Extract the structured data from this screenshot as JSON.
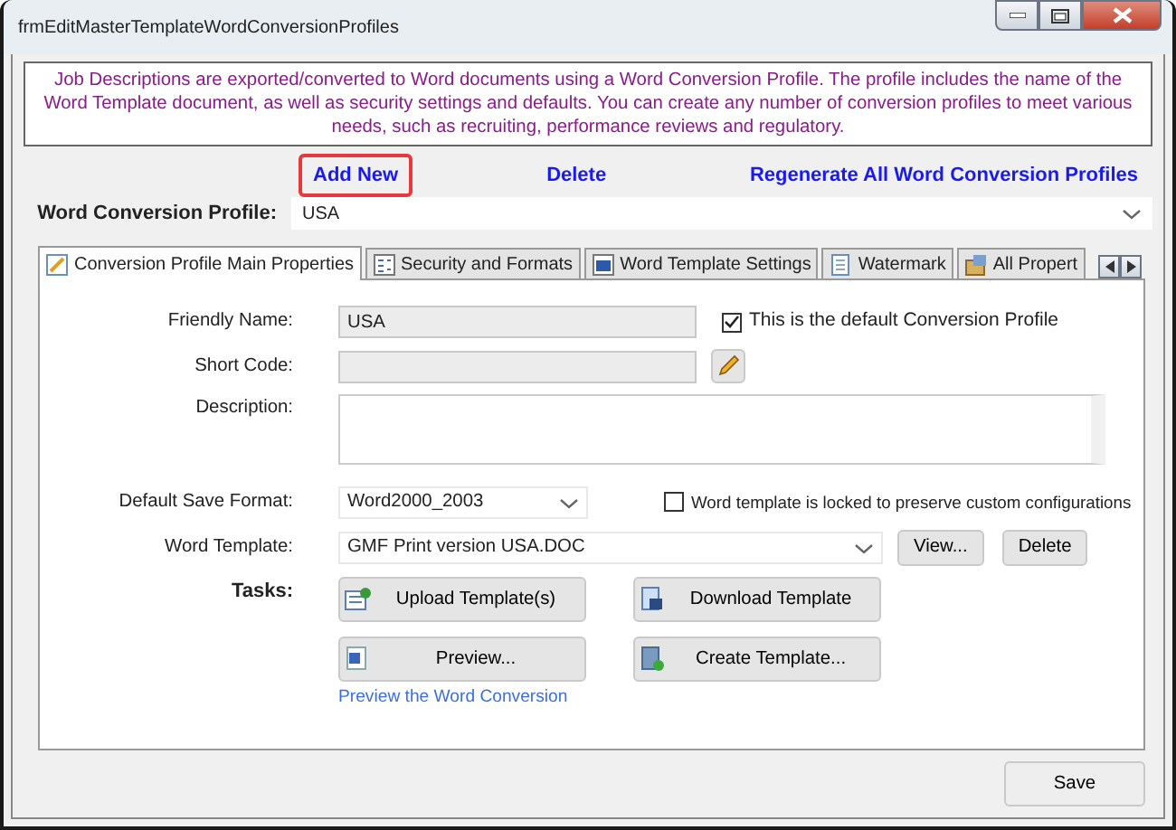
{
  "window": {
    "title": "frmEditMasterTemplateWordConversionProfiles"
  },
  "info_text": "Job Descriptions are exported/converted to Word documents using a Word Conversion Profile. The profile includes the name of the Word Template document, as well as security settings and defaults.  You can create any number of conversion profiles to meet various needs, such as recruiting, performance reviews and regulatory.",
  "actions": [
    {
      "label": "Add New",
      "highlighted": true
    },
    {
      "label": "Delete",
      "highlighted": false
    },
    {
      "label": "Regenerate All Word Conversion Profiles",
      "highlighted": false
    }
  ],
  "profile": {
    "label": "Word Conversion Profile:",
    "value": "USA"
  },
  "tabs": [
    {
      "label": "Conversion Profile Main Properties",
      "selected": true
    },
    {
      "label": "Security and Formats",
      "selected": false
    },
    {
      "label": "Word Template Settings",
      "selected": false
    },
    {
      "label": "Watermark",
      "selected": false
    },
    {
      "label": "All Propert",
      "selected": false
    }
  ],
  "form": {
    "friendly_name": {
      "label": "Friendly Name:",
      "value": "USA"
    },
    "default_profile": {
      "label": "This is the default Conversion Profile",
      "checked": true
    },
    "short_code": {
      "label": "Short Code:"
    },
    "description": {
      "label": "Description:"
    },
    "save_format": {
      "label": "Default Save Format:",
      "value": "Word2000_2003"
    },
    "locked": {
      "label": "Word template is locked to preserve custom configurations",
      "checked": false
    },
    "word_template": {
      "label": "Word Template:",
      "value": "GMF Print version USA.DOC"
    },
    "template_buttons": [
      "View...",
      "Delete"
    ]
  },
  "tasks": {
    "label": "Tasks:",
    "buttons": [
      "Upload Template(s)",
      "Download Template",
      "Preview...",
      "Create Template..."
    ],
    "link": "Preview the Word Conversion"
  },
  "save_button": "Save"
}
